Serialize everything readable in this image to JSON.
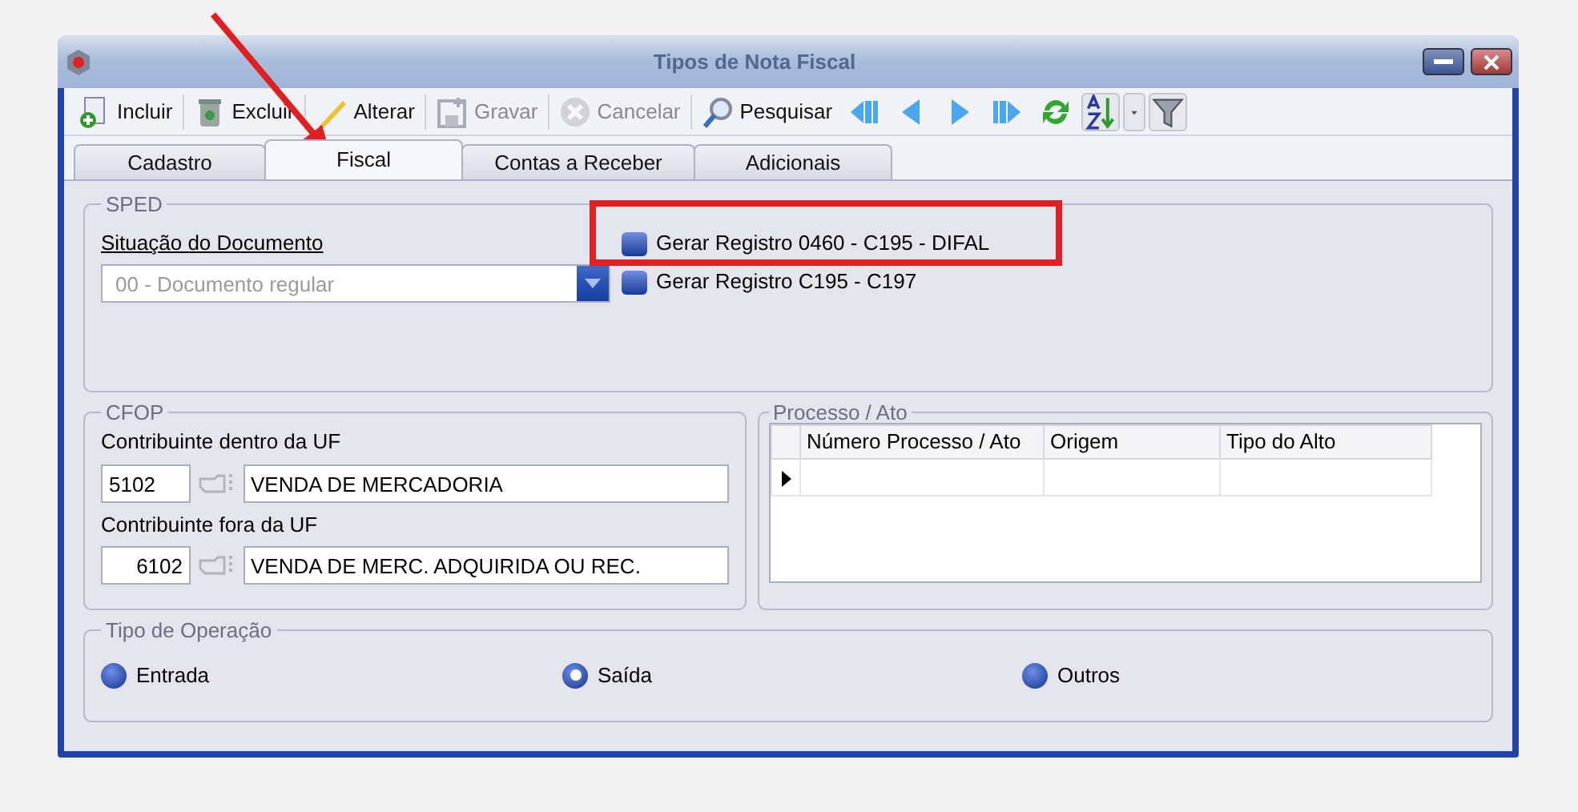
{
  "window": {
    "title": "Tipos de Nota Fiscal"
  },
  "toolbar": [
    {
      "kind": "add",
      "label": "Incluir",
      "disabled": false
    },
    {
      "kind": "delete",
      "label": "Excluir",
      "disabled": false
    },
    {
      "kind": "edit",
      "label": "Alterar",
      "disabled": false
    },
    {
      "kind": "save",
      "label": "Gravar",
      "disabled": true
    },
    {
      "kind": "cancel",
      "label": "Cancelar",
      "disabled": true
    },
    {
      "kind": "search",
      "label": "Pesquisar",
      "disabled": false
    },
    {
      "kind": "first"
    },
    {
      "kind": "prev"
    },
    {
      "kind": "next"
    },
    {
      "kind": "last"
    },
    {
      "kind": "refresh"
    },
    {
      "kind": "sort"
    },
    {
      "kind": "dropdown"
    },
    {
      "kind": "filter"
    }
  ],
  "tabs": [
    {
      "label": "Cadastro",
      "selected": false
    },
    {
      "label": "Fiscal",
      "selected": true
    },
    {
      "label": "Contas a Receber",
      "selected": false
    },
    {
      "label": "Adicionais",
      "selected": false
    }
  ],
  "sped": {
    "title": "SPED",
    "situacao_label": "Situação do Documento",
    "situacao": {
      "value": "00 - Documento regular",
      "disabled": true
    },
    "checkboxes": [
      {
        "label": "Gerar Registro 0460 - C195 - DIFAL",
        "checked": false
      },
      {
        "label": "Gerar Registro C195 - C197",
        "checked": false
      }
    ]
  },
  "cfop": {
    "title": "CFOP",
    "entries": [
      {
        "label": "Contribuinte dentro da UF",
        "code": "5102",
        "description": "VENDA DE MERCADORIA"
      },
      {
        "label": "Contribuinte fora da UF",
        "code": "6102",
        "description": "VENDA DE MERC. ADQUIRIDA OU REC."
      }
    ]
  },
  "processo": {
    "title": "Processo / Ato",
    "columns": [
      "Número Processo / Ato",
      "Origem",
      "Tipo do Alto"
    ],
    "rows": [
      {
        "current": true
      }
    ]
  },
  "tipo_operacao": {
    "title": "Tipo de Operação",
    "options": [
      {
        "label": "Entrada",
        "selected": false
      },
      {
        "label": "Saída",
        "selected": true
      },
      {
        "label": "Outros",
        "selected": false
      }
    ]
  }
}
